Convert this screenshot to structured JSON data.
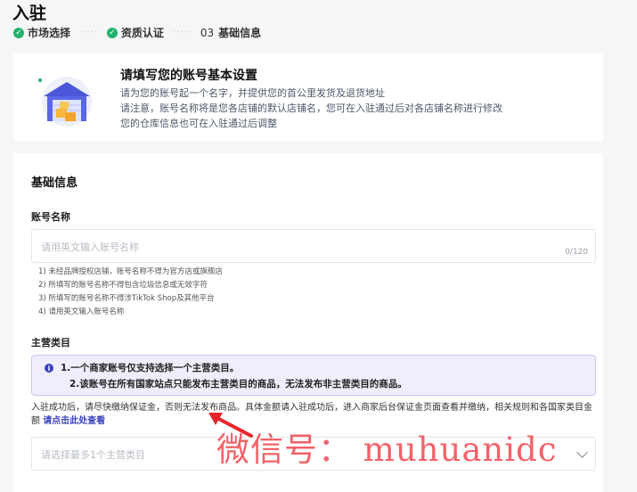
{
  "header": {
    "title": "入驻",
    "steps": [
      {
        "label": "市场选择"
      },
      {
        "label": "资质认证"
      },
      {
        "number": "03",
        "label": "基础信息"
      }
    ]
  },
  "intro": {
    "title": "请填写您的账号基本设置",
    "lines": [
      "请为您的账号起一个名字，并提供您的首公里发货及退货地址",
      "请注意，账号名称将是您各店铺的默认店铺名，您可在入驻通过后对各店铺名称进行修改",
      "您的仓库信息也可在入驻通过后调整"
    ]
  },
  "form": {
    "section_title": "基础信息",
    "account_name": {
      "label": "账号名称",
      "placeholder": "请用英文输入账号名称",
      "counter": "0/120",
      "hints": [
        "1) 未经品牌授权店铺，账号名称不得为官方店或旗舰店",
        "2) 所填写的账号名称不得包含垃圾信息或无效字符",
        "3) 所填写的账号名称不得涉TikTok Shop及其他平台",
        "4) 请用英文输入账号名称"
      ]
    },
    "category": {
      "label": "主营类目",
      "notice_lines": [
        "1.一个商家账号仅支持选择一个主营类目。",
        "2.该账号在所有国家站点只能发布主营类目的商品，无法发布非主营类目的商品。"
      ],
      "desc_text": "入驻成功后，请尽快缴纳保证金，否则无法发布商品。具体金额请入驻成功后，进入商家后台保证金页面查看并缴纳，相关规则和各国家类目金额",
      "desc_link": "请点击此处查看",
      "placeholder": "请选择最多1个主营类目"
    }
  },
  "watermark": "微信号：  muhuanidc",
  "colors": {
    "accent": "#3b3fbf",
    "success": "#21b26c",
    "watermark": "#f2474f"
  }
}
